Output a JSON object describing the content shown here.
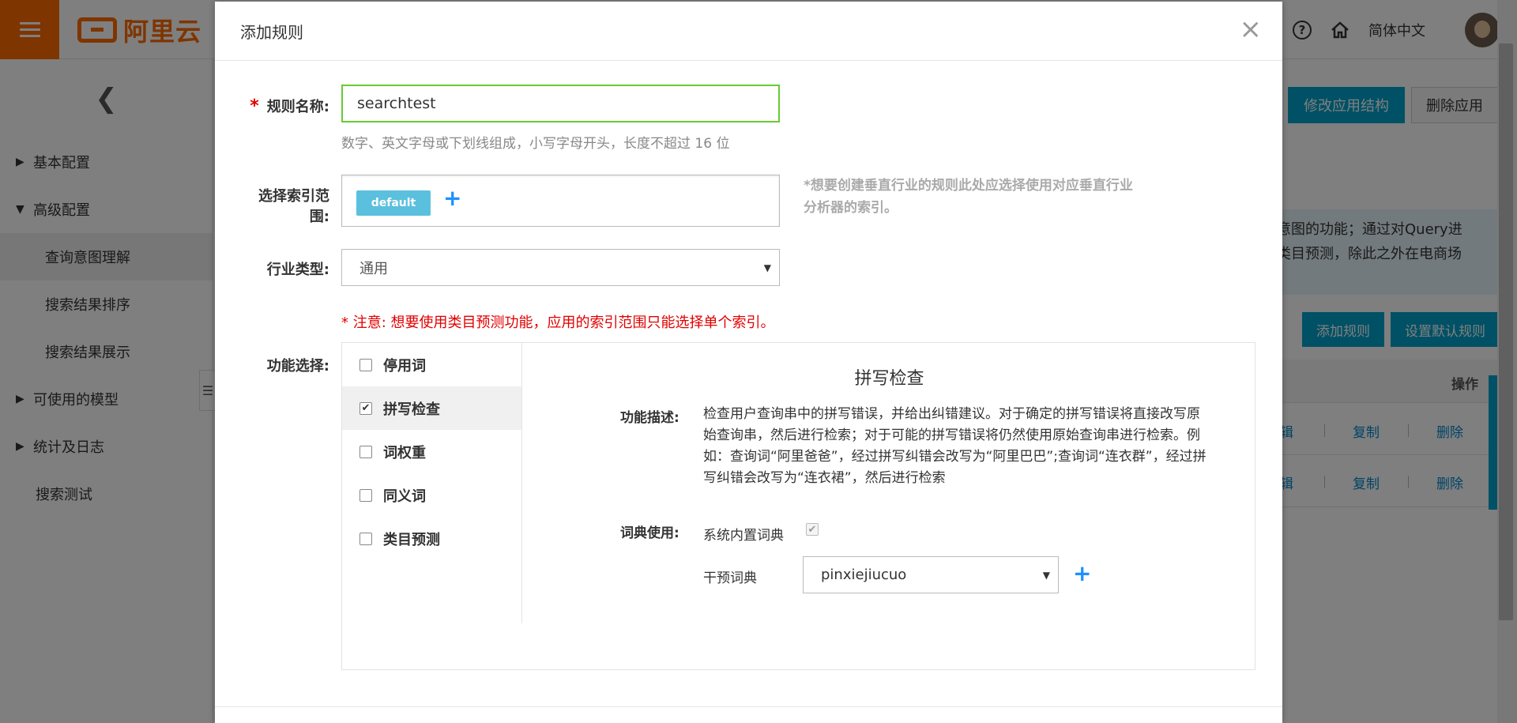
{
  "app": {
    "logo_text": "阿里云",
    "language": "简体中文",
    "icons": [
      "hamburger-icon",
      "help-icon",
      "home-icon",
      "avatar"
    ]
  },
  "sidebar": {
    "back_icon": "chevron-left-icon",
    "items": [
      {
        "label": "基本配置",
        "caret": "▶"
      },
      {
        "label": "高级配置",
        "caret": "▼"
      },
      {
        "label": "查询意图理解"
      },
      {
        "label": "搜索结果排序"
      },
      {
        "label": "搜索结果展示"
      },
      {
        "label": "可使用的模型",
        "caret": "▶"
      },
      {
        "label": "统计及日志",
        "caret": "▶"
      },
      {
        "label": "搜索测试"
      }
    ]
  },
  "background": {
    "btn_modify_app": "修改应用结构",
    "btn_delete_app": "删除应用",
    "notice_line1": "意图的功能；通过对Query进",
    "notice_line2": "类目预测，除此之外在电商场",
    "btn_add_rule": "添加规则",
    "btn_set_default": "设置默认规则",
    "col_ops": "操作",
    "row_edit": "辑",
    "row_copy": "复制",
    "row_delete": "删除"
  },
  "modal": {
    "title": "添加规则",
    "close": "×",
    "name_label": "规则名称:",
    "name_required_mark": "*",
    "name_value": "searchtest",
    "name_help": "数字、英文字母或下划线组成，小写字母开头，长度不超过 16 位",
    "index_label": "选择索引范围:",
    "index_tag": "default",
    "index_add": "+",
    "index_note": "*想要创建垂直行业的规则此处应选择使用对应垂直行业分析器的索引。",
    "industry_label": "行业类型:",
    "industry_value": "通用",
    "warning": "* 注意: 想要使用类目预测功能，应用的索引范围只能选择单个索引。",
    "feature_label": "功能选择:",
    "features": [
      {
        "label": "停用词",
        "checked": false
      },
      {
        "label": "拼写检查",
        "checked": true
      },
      {
        "label": "词权重",
        "checked": false
      },
      {
        "label": "同义词",
        "checked": false
      },
      {
        "label": "类目预测",
        "checked": false
      }
    ],
    "detail": {
      "title": "拼写检查",
      "desc_label": "功能描述:",
      "desc_text": "检查用户查询串中的拼写错误，并给出纠错建议。对于确定的拼写错误将直接改写原始查询串，然后进行检索；对于可能的拼写错误将仍然使用原始查询串进行检索。例如：查询词“阿里爸爸”，经过拼写纠错会改写为“阿里巴巴”;查询词“连衣群”，经过拼写纠错会改写为“连衣裙”，然后进行检索",
      "dict_label": "词典使用:",
      "builtin_dict_label": "系统内置词典",
      "builtin_dict_checked": true,
      "intervene_dict_label": "干预词典",
      "intervene_dict_value": "pinxiejiucuo",
      "intervene_add": "+"
    }
  }
}
